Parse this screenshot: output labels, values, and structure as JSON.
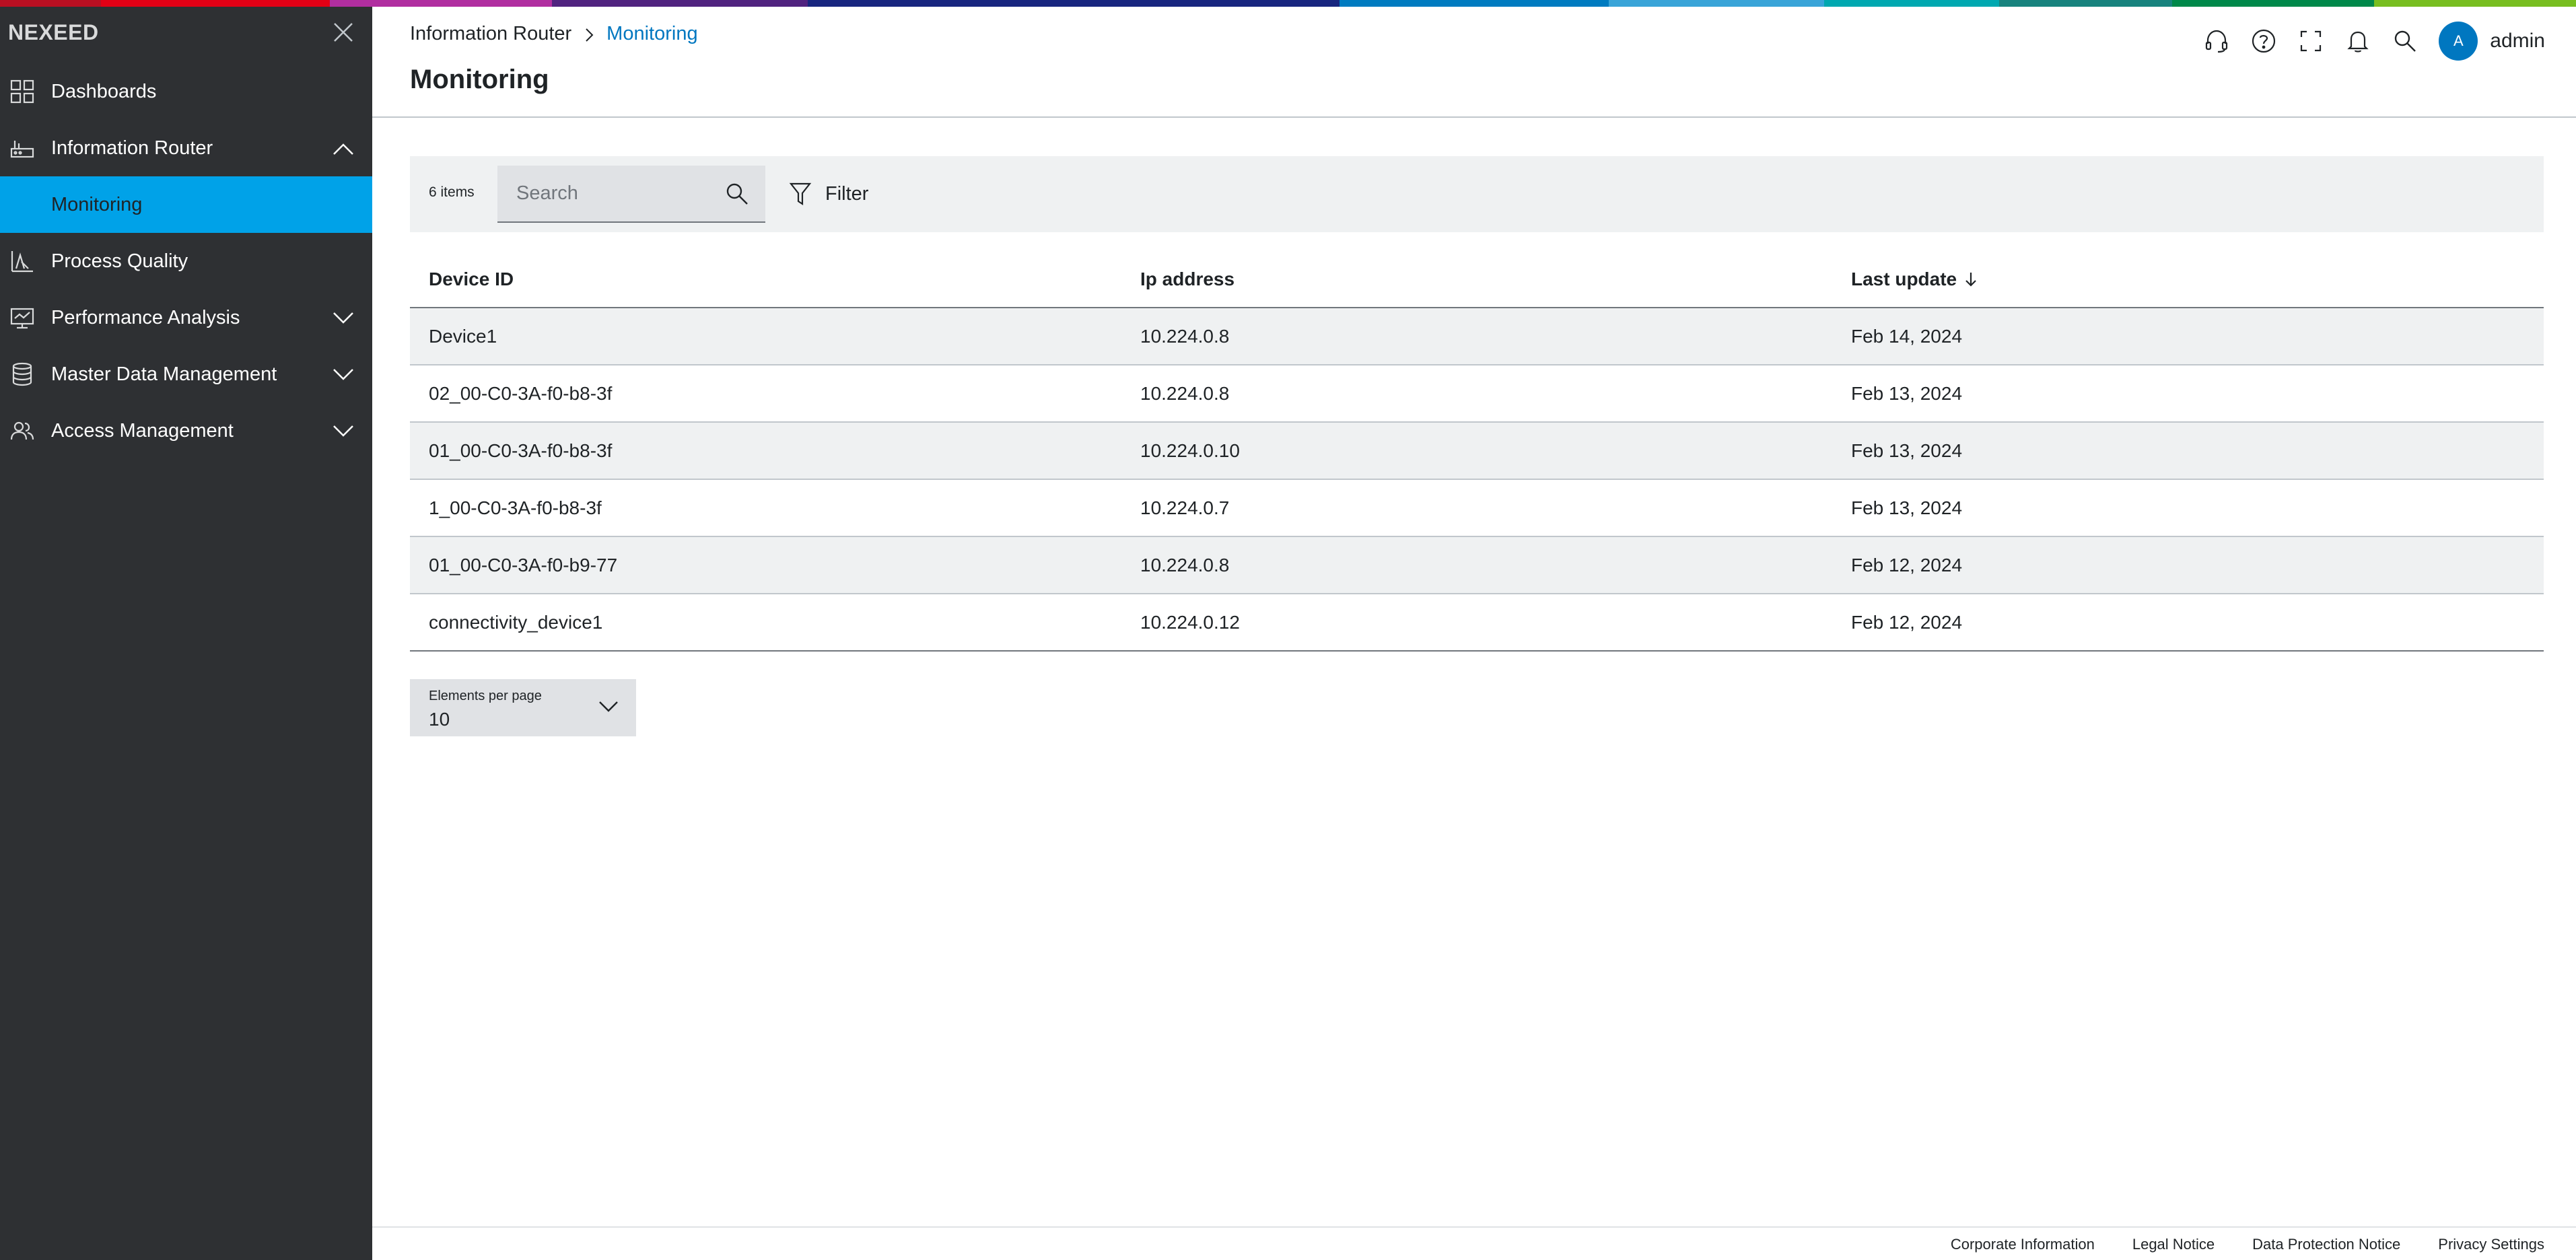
{
  "colors": {
    "rainbow": [
      "#b90f22",
      "#e20015",
      "#b12ea0",
      "#50237f",
      "#18267f",
      "#007bc0",
      "#00a8b0",
      "#18837e",
      "#00884a",
      "#78be20"
    ],
    "sidebar_bg": "#2e3033",
    "active_nav": "#00a2e8",
    "link": "#0077c0"
  },
  "sidebar": {
    "brand": "NEXEED",
    "close_icon": "close-icon",
    "items": [
      {
        "label": "Dashboards",
        "icon": "dashboard-grid-icon",
        "expandable": false
      },
      {
        "label": "Information Router",
        "icon": "router-icon",
        "expandable": true,
        "expanded": true
      },
      {
        "label": "Monitoring",
        "sub": true,
        "active": true
      },
      {
        "label": "Process Quality",
        "icon": "quality-chart-icon",
        "expandable": false
      },
      {
        "label": "Performance Analysis",
        "icon": "monitor-analysis-icon",
        "expandable": true,
        "expanded": false
      },
      {
        "label": "Master Data Management",
        "icon": "database-icon",
        "expandable": true,
        "expanded": false
      },
      {
        "label": "Access Management",
        "icon": "users-icon",
        "expandable": true,
        "expanded": false
      }
    ]
  },
  "header": {
    "breadcrumb": {
      "root": "Information Router",
      "current": "Monitoring"
    },
    "title": "Monitoring",
    "icons": [
      "headset-icon",
      "help-icon",
      "fullscreen-icon",
      "bell-icon",
      "search-icon"
    ],
    "avatar_initial": "A",
    "username": "admin"
  },
  "toolbar": {
    "items_count": "6 items",
    "search_placeholder": "Search",
    "filter_label": "Filter"
  },
  "table": {
    "columns": [
      "Device ID",
      "Ip address",
      "Last update"
    ],
    "sort_column": "Last update",
    "sort_direction": "descending",
    "rows": [
      [
        "Device1",
        "10.224.0.8",
        "Feb 14, 2024"
      ],
      [
        "02_00-C0-3A-f0-b8-3f",
        "10.224.0.8",
        "Feb 13, 2024"
      ],
      [
        "01_00-C0-3A-f0-b8-3f",
        "10.224.0.10",
        "Feb 13, 2024"
      ],
      [
        "1_00-C0-3A-f0-b8-3f",
        "10.224.0.7",
        "Feb 13, 2024"
      ],
      [
        "01_00-C0-3A-f0-b9-77",
        "10.224.0.8",
        "Feb 12, 2024"
      ],
      [
        "connectivity_device1",
        "10.224.0.12",
        "Feb 12, 2024"
      ]
    ]
  },
  "pagination": {
    "label": "Elements per page",
    "value": "10"
  },
  "footer": {
    "links": [
      "Corporate Information",
      "Legal Notice",
      "Data Protection Notice",
      "Privacy Settings"
    ]
  }
}
